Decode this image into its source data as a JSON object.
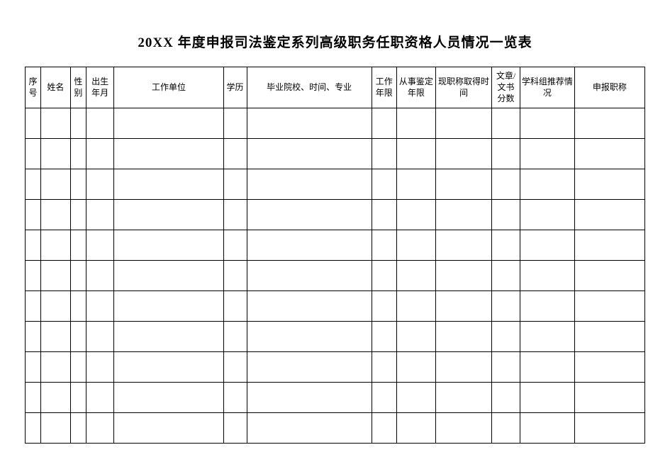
{
  "title": "20XX 年度申报司法鉴定系列高级职务任职资格人员情况一览表",
  "columns": [
    {
      "key": "seq",
      "label": "序号"
    },
    {
      "key": "name",
      "label": "姓名"
    },
    {
      "key": "gender",
      "label": "性别"
    },
    {
      "key": "birth",
      "label": "出生年月"
    },
    {
      "key": "workunit",
      "label": "工作单位"
    },
    {
      "key": "edu",
      "label": "学历"
    },
    {
      "key": "grad",
      "label": "毕业院校、时间、专业"
    },
    {
      "key": "workyears",
      "label": "工作年限"
    },
    {
      "key": "idyears",
      "label": "从事鉴定年限"
    },
    {
      "key": "titletime",
      "label": "现职称取得时间"
    },
    {
      "key": "score",
      "label": "文章/文书分数"
    },
    {
      "key": "recom",
      "label": "学科组推荐情况"
    },
    {
      "key": "apply",
      "label": "申报职称"
    }
  ],
  "rows": [
    {
      "seq": "",
      "name": "",
      "gender": "",
      "birth": "",
      "workunit": "",
      "edu": "",
      "grad": "",
      "workyears": "",
      "idyears": "",
      "titletime": "",
      "score": "",
      "recom": "",
      "apply": ""
    },
    {
      "seq": "",
      "name": "",
      "gender": "",
      "birth": "",
      "workunit": "",
      "edu": "",
      "grad": "",
      "workyears": "",
      "idyears": "",
      "titletime": "",
      "score": "",
      "recom": "",
      "apply": ""
    },
    {
      "seq": "",
      "name": "",
      "gender": "",
      "birth": "",
      "workunit": "",
      "edu": "",
      "grad": "",
      "workyears": "",
      "idyears": "",
      "titletime": "",
      "score": "",
      "recom": "",
      "apply": ""
    },
    {
      "seq": "",
      "name": "",
      "gender": "",
      "birth": "",
      "workunit": "",
      "edu": "",
      "grad": "",
      "workyears": "",
      "idyears": "",
      "titletime": "",
      "score": "",
      "recom": "",
      "apply": ""
    },
    {
      "seq": "",
      "name": "",
      "gender": "",
      "birth": "",
      "workunit": "",
      "edu": "",
      "grad": "",
      "workyears": "",
      "idyears": "",
      "titletime": "",
      "score": "",
      "recom": "",
      "apply": ""
    },
    {
      "seq": "",
      "name": "",
      "gender": "",
      "birth": "",
      "workunit": "",
      "edu": "",
      "grad": "",
      "workyears": "",
      "idyears": "",
      "titletime": "",
      "score": "",
      "recom": "",
      "apply": ""
    },
    {
      "seq": "",
      "name": "",
      "gender": "",
      "birth": "",
      "workunit": "",
      "edu": "",
      "grad": "",
      "workyears": "",
      "idyears": "",
      "titletime": "",
      "score": "",
      "recom": "",
      "apply": ""
    },
    {
      "seq": "",
      "name": "",
      "gender": "",
      "birth": "",
      "workunit": "",
      "edu": "",
      "grad": "",
      "workyears": "",
      "idyears": "",
      "titletime": "",
      "score": "",
      "recom": "",
      "apply": ""
    },
    {
      "seq": "",
      "name": "",
      "gender": "",
      "birth": "",
      "workunit": "",
      "edu": "",
      "grad": "",
      "workyears": "",
      "idyears": "",
      "titletime": "",
      "score": "",
      "recom": "",
      "apply": ""
    },
    {
      "seq": "",
      "name": "",
      "gender": "",
      "birth": "",
      "workunit": "",
      "edu": "",
      "grad": "",
      "workyears": "",
      "idyears": "",
      "titletime": "",
      "score": "",
      "recom": "",
      "apply": ""
    },
    {
      "seq": "",
      "name": "",
      "gender": "",
      "birth": "",
      "workunit": "",
      "edu": "",
      "grad": "",
      "workyears": "",
      "idyears": "",
      "titletime": "",
      "score": "",
      "recom": "",
      "apply": ""
    }
  ]
}
